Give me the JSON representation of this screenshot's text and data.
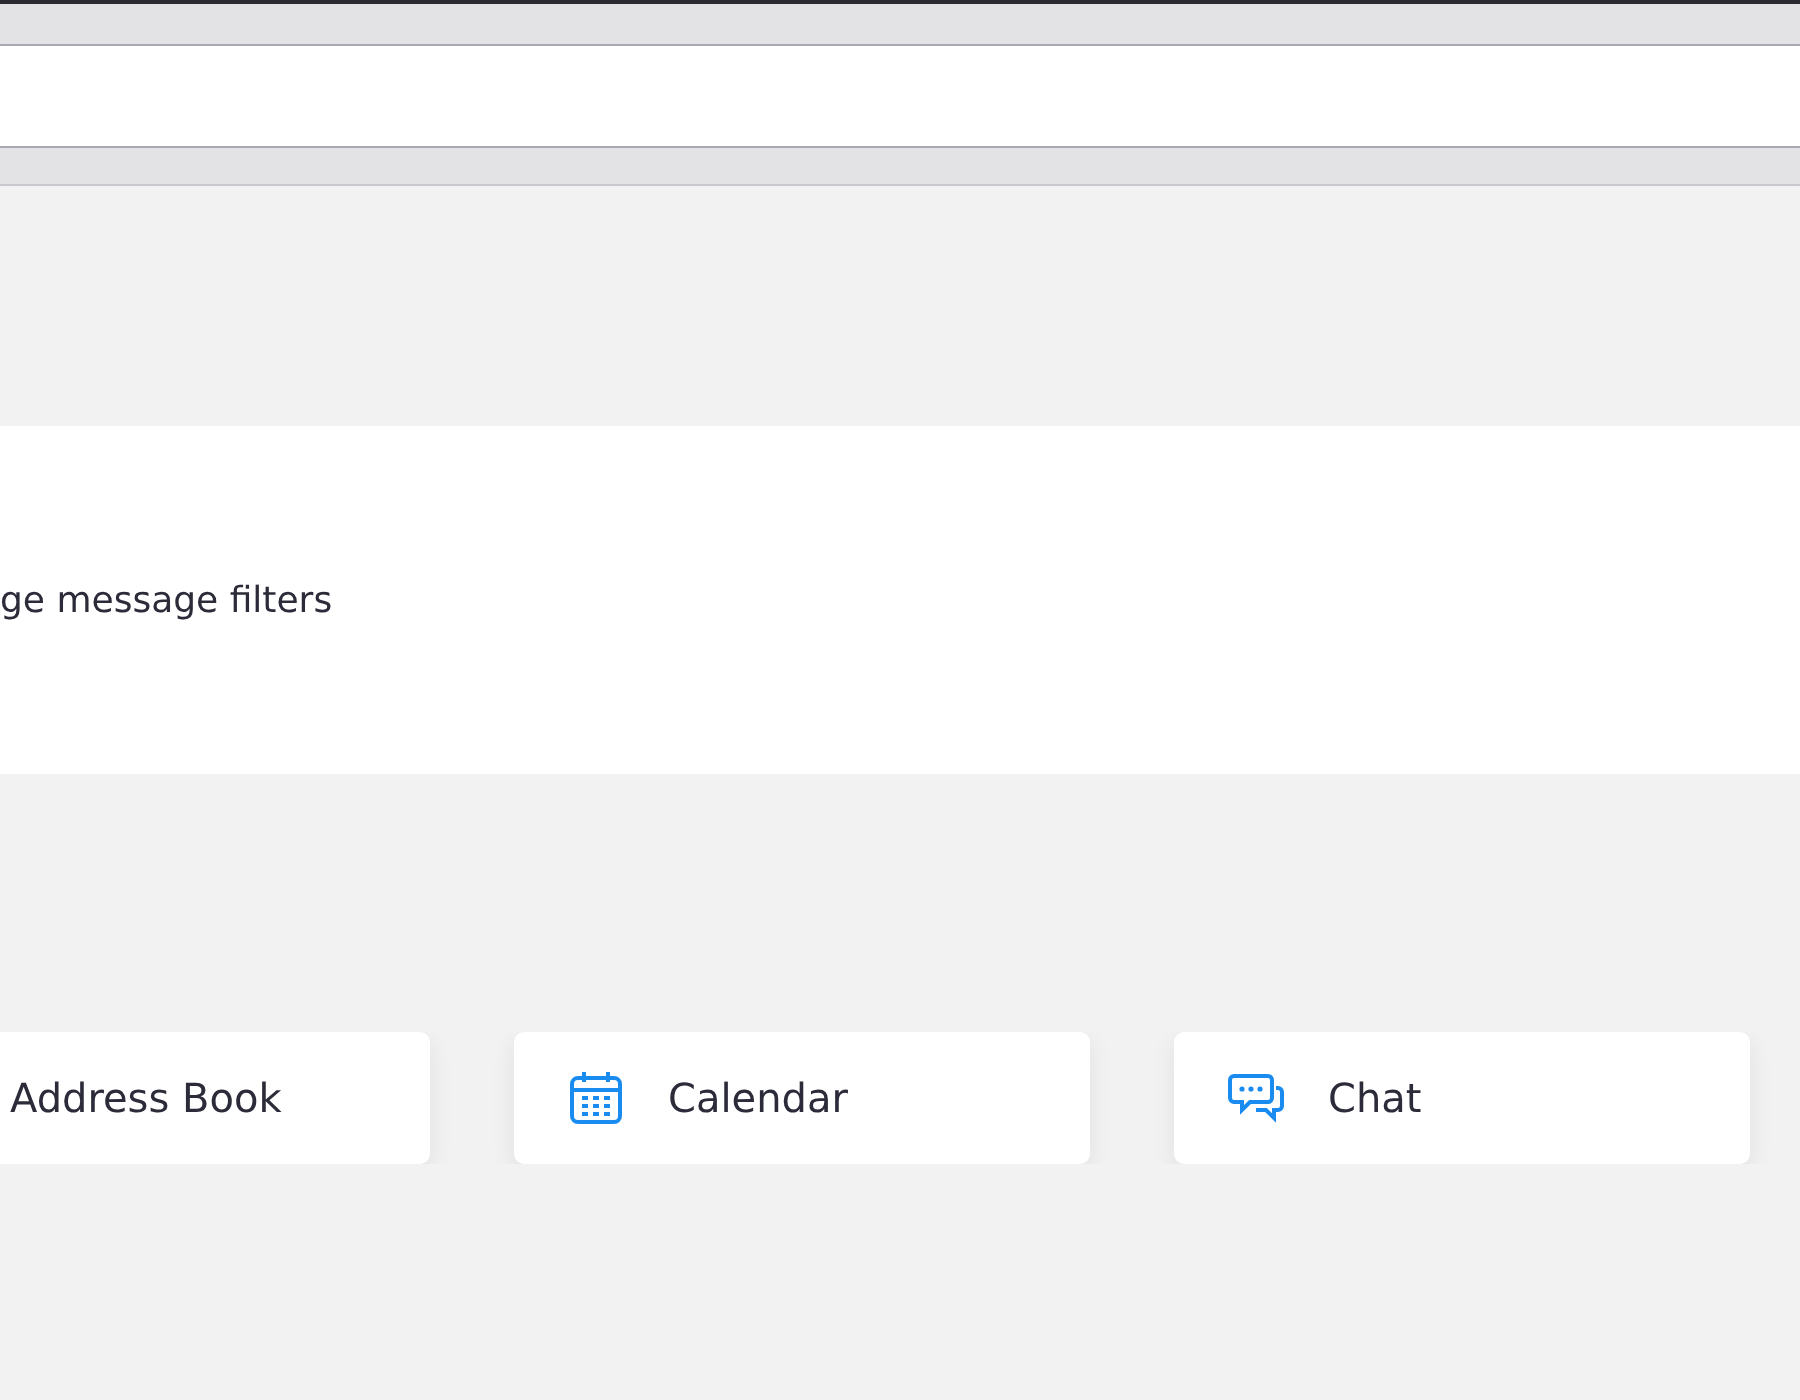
{
  "panel": {
    "text": "ge message filters"
  },
  "shortcuts": [
    {
      "label": "Address Book",
      "kind": "plain"
    },
    {
      "label": "Calendar",
      "kind": "calendar"
    },
    {
      "label": "Chat",
      "kind": "chat"
    }
  ]
}
